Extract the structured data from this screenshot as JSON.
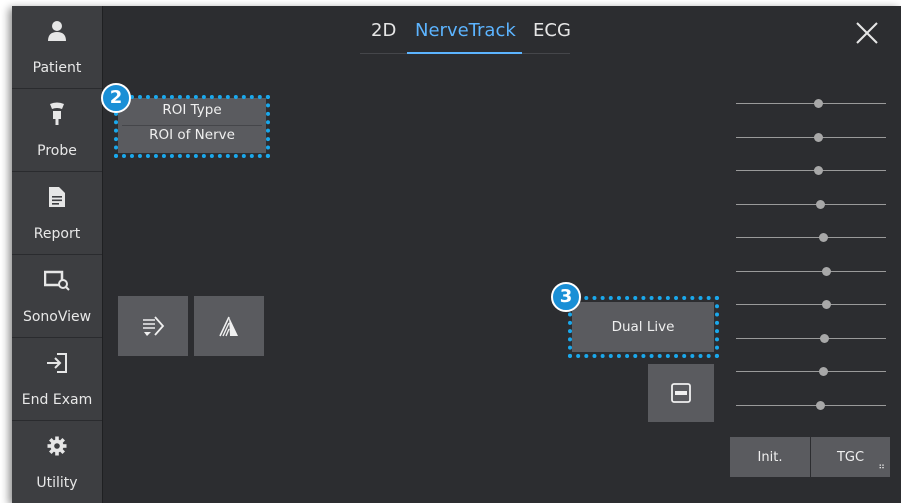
{
  "sidebar": {
    "items": [
      {
        "label": "Patient",
        "icon": "patient-icon"
      },
      {
        "label": "Probe",
        "icon": "probe-icon"
      },
      {
        "label": "Report",
        "icon": "report-icon"
      },
      {
        "label": "SonoView",
        "icon": "sonoview-icon"
      },
      {
        "label": "End Exam",
        "icon": "end-exam-icon"
      },
      {
        "label": "Utility",
        "icon": "gear-icon"
      }
    ]
  },
  "tabs": [
    {
      "label": "2D",
      "active": false
    },
    {
      "label": "NerveTrack",
      "active": true
    },
    {
      "label": "ECG",
      "active": false
    }
  ],
  "roi": {
    "type_label": "ROI Type",
    "value": "ROI of Nerve",
    "badge": "2"
  },
  "dual_live": {
    "label": "Dual Live",
    "badge": "3"
  },
  "bottom": {
    "init_label": "Init.",
    "tgc_label": "TGC"
  },
  "colors": {
    "accent": "#5cb4ff",
    "highlight": "#1aa8ec",
    "background": "#2c2d30",
    "button": "#5a5b5f"
  },
  "tgc_sliders": [
    0.55,
    0.55,
    0.55,
    0.56,
    0.58,
    0.6,
    0.6,
    0.59,
    0.58,
    0.56
  ]
}
